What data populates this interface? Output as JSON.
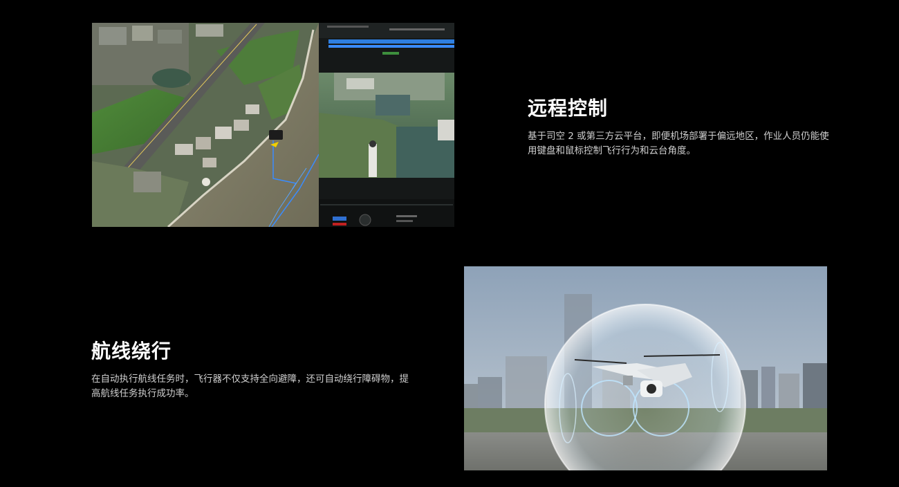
{
  "features": {
    "remote_control": {
      "title": "远程控制",
      "description": "基于司空 2 或第三方云平台，即便机场部署于偏远地区，作业人员仍能使用键盘和鼠标控制飞行行为和云台角度。"
    },
    "route_bypass": {
      "title": "航线绕行",
      "description": "在自动执行航线任务时，飞行器不仅支持全向避障，还可自动绕行障碍物，提高航线任务执行成功率。"
    }
  },
  "colors": {
    "background": "#000000",
    "title": "#ffffff",
    "body_text": "#cfcfcf",
    "route_line": "#3a8cff",
    "progress_bar": "#2f7fe0"
  }
}
